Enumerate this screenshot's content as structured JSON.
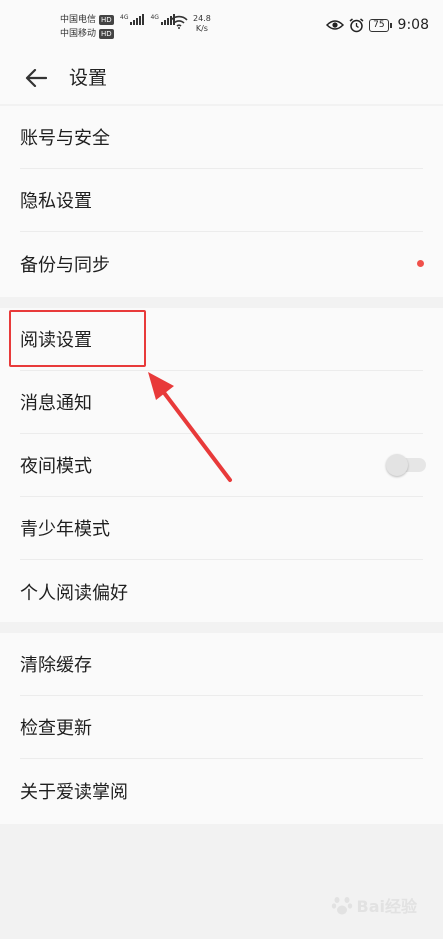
{
  "status_bar": {
    "carrier1": "中国电信",
    "carrier2": "中国移动",
    "hd_badge": "HD",
    "network_label": "4G",
    "speed_value": "24.8",
    "speed_unit": "K/s",
    "battery": "75",
    "time": "9:08"
  },
  "header": {
    "title": "设置"
  },
  "groups": [
    {
      "items": [
        {
          "label": "账号与安全"
        },
        {
          "label": "隐私设置"
        },
        {
          "label": "备份与同步"
        }
      ]
    },
    {
      "items": [
        {
          "label": "阅读设置"
        },
        {
          "label": "消息通知"
        },
        {
          "label": "夜间模式",
          "toggle_on": false
        },
        {
          "label": "青少年模式"
        },
        {
          "label": "个人阅读偏好"
        }
      ]
    },
    {
      "items": [
        {
          "label": "清除缓存"
        },
        {
          "label": "检查更新"
        },
        {
          "label": "关于爱读掌阅"
        }
      ]
    }
  ],
  "colors": {
    "accent_red": "#e83a3a",
    "badge_dot": "#f0504a",
    "background": "#f2f2f2",
    "surface": "#fafafa"
  },
  "watermark": {
    "text": "Bai经验"
  }
}
